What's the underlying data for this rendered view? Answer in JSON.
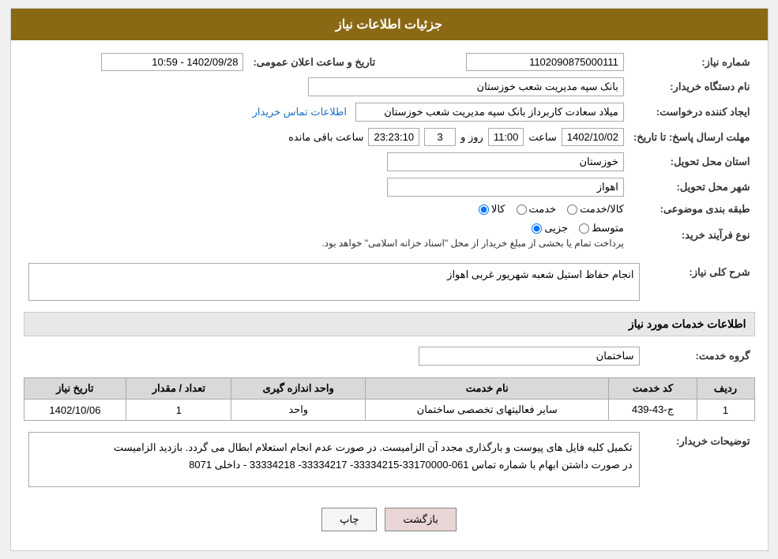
{
  "page": {
    "title": "جزئیات اطلاعات نیاز"
  },
  "header": {
    "label": "شماره نیاز",
    "value": "1102090875000111"
  },
  "fields": {
    "need_number_label": "شماره نیاز:",
    "need_number_value": "1102090875000111",
    "buyer_name_label": "نام دستگاه خریدار:",
    "buyer_name_value": "بانک سپه مدیریت شعب خوزستان",
    "creator_label": "ایجاد کننده درخواست:",
    "creator_value": "میلاد سعادت کاربرداز بانک سپه مدیریت شعب خوزستان",
    "creator_link": "اطلاعات تماس خریدار",
    "deadline_label": "مهلت ارسال پاسخ: تا تاریخ:",
    "deadline_date": "1402/10/02",
    "deadline_time_label": "ساعت",
    "deadline_time": "11:00",
    "deadline_days_label": "روز و",
    "deadline_days": "3",
    "deadline_remaining_label": "ساعت باقی مانده",
    "deadline_remaining": "23:23:10",
    "province_label": "استان محل تحویل:",
    "province_value": "خوزستان",
    "city_label": "شهر محل تحویل:",
    "city_value": "اهواز",
    "category_label": "طبقه بندی موضوعی:",
    "category_options": [
      "کالا",
      "خدمت",
      "کالا/خدمت"
    ],
    "category_selected": "کالا",
    "purchase_type_label": "نوع فرآیند خرید:",
    "purchase_options": [
      "جزیی",
      "متوسط"
    ],
    "purchase_note": "پرداخت تمام یا بخشی از مبلغ خریدار از محل \"اسناد خزانه اسلامی\" خواهد بود.",
    "description_label": "شرح کلی نیاز:",
    "description_value": "انجام حفاظ استیل شعبه شهریور غربی اهواز"
  },
  "service_section": {
    "title": "اطلاعات خدمات مورد نیاز",
    "group_label": "گروه خدمت:",
    "group_value": "ساختمان",
    "table": {
      "columns": [
        "ردیف",
        "کد خدمت",
        "نام خدمت",
        "واحد اندازه گیری",
        "تعداد / مقدار",
        "تاریخ نیاز"
      ],
      "rows": [
        {
          "row_num": "1",
          "code": "ج-43-439",
          "name": "سایر فعالیتهای تخصصی ساختمان",
          "unit": "واحد",
          "count": "1",
          "date": "1402/10/06"
        }
      ]
    }
  },
  "notes": {
    "label": "توضیحات خریدار:",
    "text": "تکمیل کلیه فایل های پیوست و بارگذاری مجدد آن الزامیست. در صورت عدم انجام استعلام ابطال می گردد. بازدید الزامیست\nدر صورت داشتن ابهام با شماره تماس 061-33170000-33334215- 33334217- 33334218 - داخلی 8071"
  },
  "buttons": {
    "print": "چاپ",
    "back": "بازگشت"
  },
  "announce_datetime_label": "تاریخ و ساعت اعلان عمومی:",
  "announce_datetime_value": "1402/09/28 - 10:59"
}
